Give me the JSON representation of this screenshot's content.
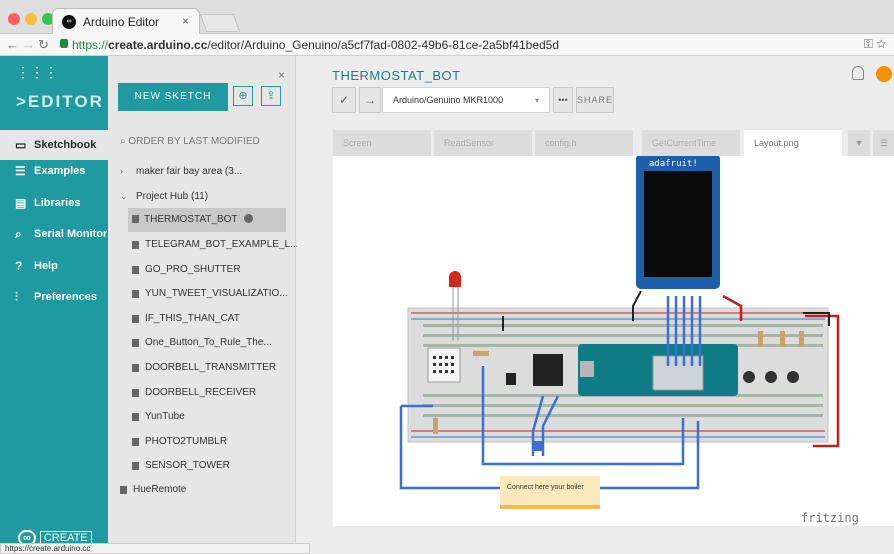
{
  "browser": {
    "tab_title": "Arduino Editor",
    "tab_close": "×",
    "url_scheme": "https://",
    "url_host": "create.arduino.cc",
    "url_path": "/editor/Arduino_Genuino/a5cf7fad-0802-49b6-81ce-2a5bf41bed5d",
    "status_url": "https://create.arduino.cc"
  },
  "sidebar": {
    "logo": ">EDITOR",
    "create_label": "CREATE",
    "items": [
      {
        "label": "Sketchbook",
        "icon": "folder-icon"
      },
      {
        "label": "Examples",
        "icon": "list-icon"
      },
      {
        "label": "Libraries",
        "icon": "library-icon"
      },
      {
        "label": "Serial Monitor",
        "icon": "serial-monitor-icon"
      },
      {
        "label": "Help",
        "icon": "help-icon"
      },
      {
        "label": "Preferences",
        "icon": "sliders-icon"
      }
    ]
  },
  "panel": {
    "new_sketch": "NEW SKETCH",
    "sort_label": "ORDER BY LAST MODIFIED",
    "folders": [
      {
        "label": "maker fair bay area (3..."
      },
      {
        "label": "Project Hub (11)"
      }
    ],
    "sketches": [
      "THERMOSTAT_BOT",
      "TELEGRAM_BOT_EXAMPLE_L...",
      "GO_PRO_SHUTTER",
      "YUN_TWEET_VISUALIZATIO...",
      "IF_THIS_THAN_CAT",
      "One_Button_To_Rule_The...",
      "DOORBELL_TRANSMITTER",
      "DOORBELL_RECEIVER",
      "YunTube",
      "PHOTO2TUMBLR",
      "SENSOR_TOWER"
    ],
    "root_sketch": "HueRemote"
  },
  "editor": {
    "sketch_title": "THERMOSTAT_BOT",
    "board": "Arduino/Genuino MKR1000",
    "more": "•••",
    "share": "SHARE",
    "file_tabs": [
      "Screen",
      "ReadSensor",
      "config.h",
      "GetCurrentTime",
      "Layout.png"
    ],
    "active_tab": "Layout.png"
  },
  "diagram": {
    "display_brand": "adafruit!",
    "note": "Connect here your boiler",
    "watermark": "fritzing"
  },
  "colors": {
    "accent": "#1e9aa0",
    "avatar": "#f39200",
    "breadboard": "#dcdcdc",
    "board_teal": "#0f7b85",
    "wire_blue": "#3b6fd1",
    "wire_red": "#c0201b"
  }
}
